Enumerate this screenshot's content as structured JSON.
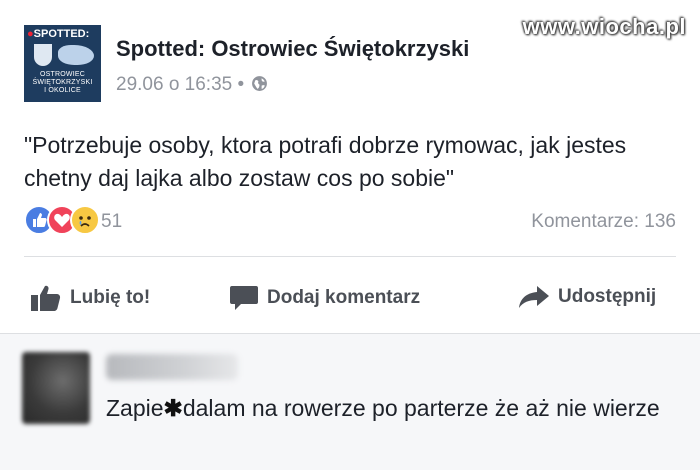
{
  "watermark": "www.wiocha.pl",
  "page": {
    "avatar_brand": "SPOTTED:",
    "avatar_sub_lines": [
      "OSTROWIEC",
      "ŚWIĘTOKRZYSKI",
      "I OKOLICE"
    ],
    "name": "Spotted: Ostrowiec Świętokrzyski",
    "date": "29.06 o 16:35",
    "separator": "•",
    "privacy_icon": "globe-icon"
  },
  "post": {
    "text": "\"Potrzebuje osoby, ktora potrafi dobrze rymowac, jak jestes chetny daj lajka albo zostaw cos po sobie\""
  },
  "reactions": {
    "icons": [
      "like-reaction-icon",
      "love-reaction-icon",
      "sad-reaction-icon"
    ],
    "count": "51",
    "comments_label": "Komentarze: 136"
  },
  "actions": {
    "like": "Lubię to!",
    "comment": "Dodaj komentarz",
    "share": "Udostępnij"
  },
  "comment": {
    "text_before": "Zapie",
    "censor_mark": "✱",
    "text_after": "dalam na rowerze po parterze że aż nie wierze"
  },
  "colors": {
    "text": "#1d2129",
    "meta": "#90949c",
    "action": "#4b4f56",
    "like": "#4a7de2",
    "love": "#f0435a",
    "sad": "#f7c843",
    "comment_bg": "#f6f7f9"
  }
}
